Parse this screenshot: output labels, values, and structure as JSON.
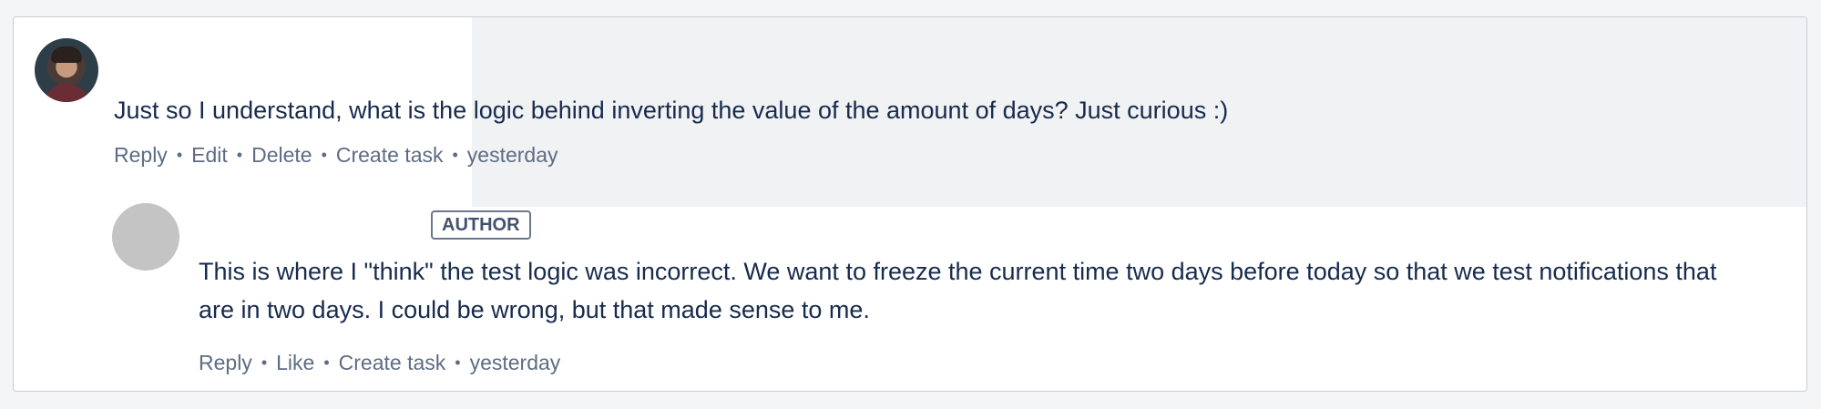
{
  "thread": {
    "comments": [
      {
        "avatar": "user-photo-avatar",
        "text": "Just so I understand, what is the logic behind inverting the value of the amount of days? Just curious :)",
        "actions": [
          "Reply",
          "Edit",
          "Delete",
          "Create task"
        ],
        "timestamp": "yesterday"
      },
      {
        "avatar": "blank-avatar",
        "badge": "AUTHOR",
        "text": "This is where I \"think\" the test logic was incorrect. We want to freeze the current time two days before today so that we test notifications that are in two days. I could be wrong, but that made sense to me.",
        "actions": [
          "Reply",
          "Like",
          "Create task"
        ],
        "timestamp": "yesterday"
      }
    ],
    "separator": "•"
  },
  "colors": {
    "page_bg": "#f4f5f7",
    "panel_bg": "#ffffff",
    "highlight_bg": "#f1f2f4",
    "text": "#172b4d",
    "muted": "#5e6c84"
  }
}
